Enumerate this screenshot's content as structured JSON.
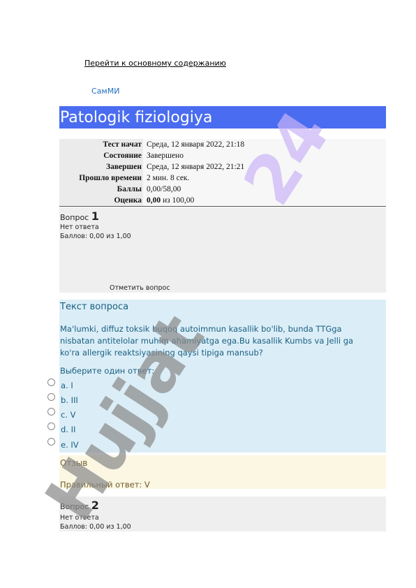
{
  "skip_link": "Перейти к основному содержанию",
  "brand": "СамМИ",
  "course_title": "Patologik fiziologiya",
  "summary": [
    {
      "label": "Тест начат",
      "value": "Среда, 12 января 2022, 21:18"
    },
    {
      "label": "Состояние",
      "value": "Завершено"
    },
    {
      "label": "Завершен",
      "value": "Среда, 12 января 2022, 21:21"
    },
    {
      "label": "Прошло времени",
      "value": "2 мин. 8 сек."
    },
    {
      "label": "Баллы",
      "value": "0,00/58,00"
    },
    {
      "label": "Оценка",
      "value_bold": "0,00",
      "value_rest": " из 100,00"
    }
  ],
  "question1": {
    "prefix": "Вопрос",
    "number": "1",
    "status": "Нет ответа",
    "points": "Баллов: 0,00 из 1,00",
    "flag": "Отметить вопрос",
    "text_heading": "Текст вопроса",
    "text": "Ma'lumki, diffuz toksik buqoq autoimmun kasallik bo'lib, bunda TTGga nisbatan antitelolar muhim ahamiyatga ega.Bu kasallik Kumbs va Jelli ga ko'ra allergik reaktsiyasining qaysi tipiga mansub?",
    "prompt": "Выберите один ответ:",
    "options": [
      "a. I",
      "b. III",
      "c. V",
      "d. II",
      "e. IV"
    ],
    "feedback_heading": "Отзыв",
    "correct_answer": "Правильный ответ: V"
  },
  "question2": {
    "prefix": "Вопрос",
    "number": "2",
    "status": "Нет ответа",
    "points": "Баллов: 0,00 из 1,00"
  },
  "watermark": {
    "main": "Hujjat",
    "accent": "24",
    "colors": {
      "main": "#8a8a8a",
      "accent": "#c9b3f7"
    }
  }
}
